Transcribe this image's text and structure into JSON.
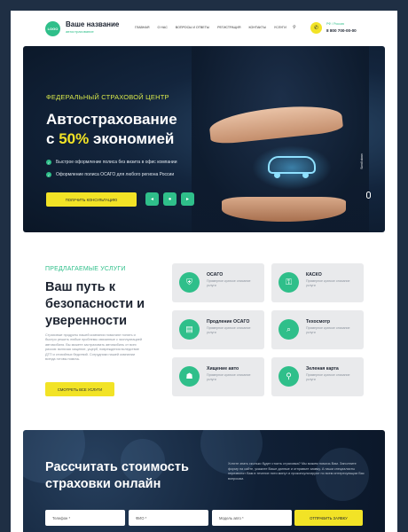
{
  "header": {
    "logo": "LOGO",
    "brand_name": "Ваше название",
    "brand_sub": "автострахование",
    "nav": [
      "Главная",
      "О нас",
      "Вопросы и ответы",
      "Регистрация",
      "Контакты",
      "Услуги"
    ],
    "search_icon": "search-icon",
    "phone_city": "РФ / Россия",
    "phone_number": "8 800 700-00-00"
  },
  "hero": {
    "subtitle": "ФЕДЕРАЛЬНЫЙ СТРАХОВОЙ ЦЕНТР",
    "title_line1": "Автострахование",
    "title_pre": "с ",
    "title_accent": "50%",
    "title_post": " экономией",
    "features": [
      "Быстрое оформление полиса без визита в офис компании",
      "Оформление полиса ОСАГО для любого региона России"
    ],
    "cta": "Получить консультацию",
    "scroll_label": "Scroll down",
    "arrows": [
      "◂",
      "●",
      "▸"
    ]
  },
  "services": {
    "subtitle": "Предлагаемые услуги",
    "title": "Ваш путь к безопасности и уверенности",
    "text": "Страховые продукты нашей компании помогают понять и быстро решить любые проблемы связанные с эксплуатацией автомобиля. Вы можете застраховать автомобиль от всех рисков: включая хищение, ущерб, повреждения вследствие ДТП и стихийных бедствий. Сотрудники нашей компании всегда готовы помочь.",
    "cta": "Смотреть все услуги",
    "cards": [
      {
        "title": "ОСАГО",
        "desc": "Примерное краткое описание услуги"
      },
      {
        "title": "КАСКО",
        "desc": "Примерное краткое описание услуги"
      },
      {
        "title": "Продление ОСАГО",
        "desc": "Примерное краткое описание услуги"
      },
      {
        "title": "Техосмотр",
        "desc": "Примерное краткое описание услуги"
      },
      {
        "title": "Хищение авто",
        "desc": "Примерное краткое описание услуги"
      },
      {
        "title": "Зеленая карта",
        "desc": "Примерное краткое описание услуги"
      }
    ]
  },
  "calc": {
    "title": "Рассчитать стоимость страховки онлайн",
    "text": "Хотите знать сколько будет стоить страховка? Мы можем помочь Вам. Заполните форму на сайте, укажите Ваше данные и отправьте заявку. А наши специалисты перезвонят Вам в течение пяти минут и проконсультируют по всем интересующим Вас вопросам.",
    "phone_placeholder": "Телефон *",
    "name_placeholder": "ФИО *",
    "model_placeholder": "Модель авто *",
    "submit": "Отправить заявку"
  },
  "colors": {
    "accent_green": "#2fbf8a",
    "accent_yellow": "#f2e326",
    "dark_navy": "#13253d"
  }
}
